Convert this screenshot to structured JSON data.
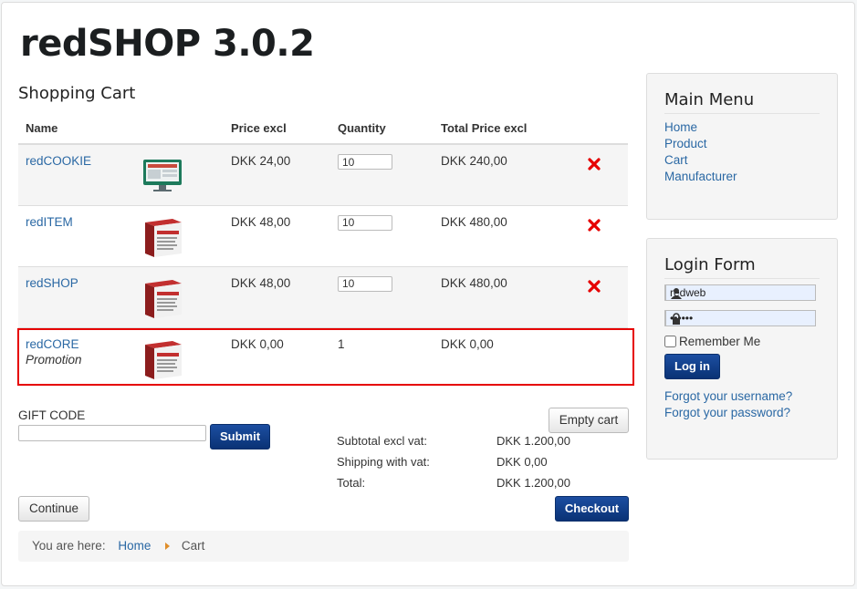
{
  "header": {
    "site_title": "redSHOP 3.0.2",
    "page_heading": "Shopping Cart"
  },
  "cart": {
    "columns": {
      "name": "Name",
      "price": "Price excl",
      "quantity": "Quantity",
      "total": "Total Price excl"
    },
    "items": [
      {
        "name": "redCOOKIE",
        "promo": "",
        "price": "DKK 24,00",
        "quantity": "10",
        "total": "DKK 240,00",
        "image_icon": "monitor-product-image"
      },
      {
        "name": "redITEM",
        "promo": "",
        "price": "DKK 48,00",
        "quantity": "10",
        "total": "DKK 480,00",
        "image_icon": "product-box-image"
      },
      {
        "name": "redSHOP",
        "promo": "",
        "price": "DKK 48,00",
        "quantity": "10",
        "total": "DKK 480,00",
        "image_icon": "product-box-image"
      },
      {
        "name": "redCORE",
        "promo": "Promotion",
        "price": "DKK 0,00",
        "quantity": "1",
        "total": "DKK 0,00",
        "image_icon": "product-box-image"
      }
    ],
    "highlight_color": "#e60000",
    "delete_color": "#e60000"
  },
  "gift": {
    "label": "GIFT CODE",
    "value": "",
    "submit_label": "Submit"
  },
  "buttons": {
    "empty_cart": "Empty cart",
    "checkout": "Checkout",
    "continue": "Continue"
  },
  "totals": {
    "subtotal_label": "Subtotal excl vat:",
    "subtotal_value": "DKK 1.200,00",
    "shipping_label": "Shipping with vat:",
    "shipping_value": "DKK 0,00",
    "total_label": "Total:",
    "total_value": "DKK 1.200,00"
  },
  "breadcrumb": {
    "prefix": "You are here:",
    "home": "Home",
    "current": "Cart"
  },
  "main_menu": {
    "title": "Main Menu",
    "items": [
      "Home",
      "Product",
      "Cart",
      "Manufacturer"
    ]
  },
  "login": {
    "title": "Login Form",
    "username": "redweb",
    "password": "••••••",
    "remember": "Remember Me",
    "login_label": "Log in",
    "forgot_username": "Forgot your username?",
    "forgot_password": "Forgot your password?"
  },
  "colors": {
    "link": "#2a68a4",
    "primary_button": "#0a3275",
    "accent_arrow": "#e08e2a"
  }
}
